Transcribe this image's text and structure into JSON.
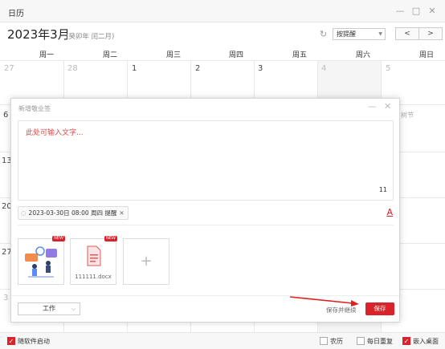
{
  "window": {
    "title": "日历",
    "min_icon": "minimize-icon",
    "max_icon": "maximize-icon",
    "close_icon": "close-icon"
  },
  "header": {
    "month_title": "2023年3月",
    "lunar_info": "(癸卯年 闰二月)",
    "reminder_select": "按提醒",
    "prev": "<",
    "next": ">"
  },
  "weekdays": [
    "周一",
    "周二",
    "周三",
    "周四",
    "周五",
    "周六",
    "周日"
  ],
  "calendar": {
    "row1": [
      "27",
      "28",
      "1",
      "2",
      "3",
      "4",
      "5"
    ],
    "row_partial_left": [
      "6",
      "13",
      "20",
      "27",
      "3"
    ],
    "partial_festival": "树节"
  },
  "dialog": {
    "title": "新增敬业签",
    "placeholder": "此处可输入文字...",
    "char_count": "11",
    "reminder_tag": "2023-03-30日 08:00 周四 提醒",
    "font_label": "A",
    "attachments": [
      {
        "badge": "NEW",
        "kind": "image"
      },
      {
        "badge": "NEW",
        "kind": "doc",
        "name": "111111.docx"
      }
    ],
    "add_label": "+",
    "category": "工作",
    "save_continue": "保存并继续",
    "save": "保存"
  },
  "footer": {
    "autostart": "随软件启动",
    "lunar": "农历",
    "daily_repeat": "每日重复",
    "embed_desktop": "嵌入桌面",
    "checked_mark": "✓"
  },
  "colors": {
    "accent": "#d9222a",
    "placeholder": "#e04a4a"
  }
}
